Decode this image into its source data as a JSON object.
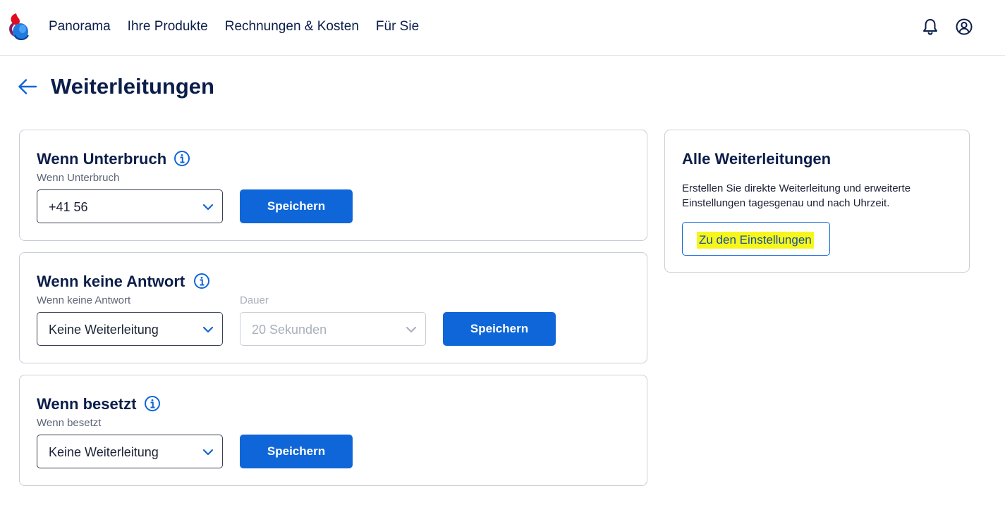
{
  "header": {
    "nav": [
      "Panorama",
      "Ihre Produkte",
      "Rechnungen & Kosten",
      "Für Sie"
    ],
    "icons": [
      "bell-icon",
      "user-account-icon"
    ]
  },
  "page": {
    "title": "Weiterleitungen"
  },
  "cards": {
    "unterbruch": {
      "title": "Wenn Unterbruch",
      "field_label": "Wenn Unterbruch",
      "select_value": "+41 56",
      "button": "Speichern"
    },
    "keine_antwort": {
      "title": "Wenn keine Antwort",
      "field_label": "Wenn keine Antwort",
      "select_value": "Keine Weiterleitung",
      "duration_label": "Dauer",
      "duration_value": "20 Sekunden",
      "button": "Speichern"
    },
    "besetzt": {
      "title": "Wenn besetzt",
      "field_label": "Wenn besetzt",
      "select_value": "Keine Weiterleitung",
      "button": "Speichern"
    }
  },
  "sidebar": {
    "title": "Alle Weiterleitungen",
    "description": "Erstellen Sie direkte Weiterleitung und erweiterte Einstellungen tagesgenau und nach Uhrzeit.",
    "button": "Zu den Einstellungen"
  },
  "colors": {
    "primary": "#0f66d8",
    "text_dark": "#0b1e4a",
    "highlight": "#f6f61c",
    "logo_red": "#e10a1e",
    "logo_blue": "#1f7ae0"
  }
}
